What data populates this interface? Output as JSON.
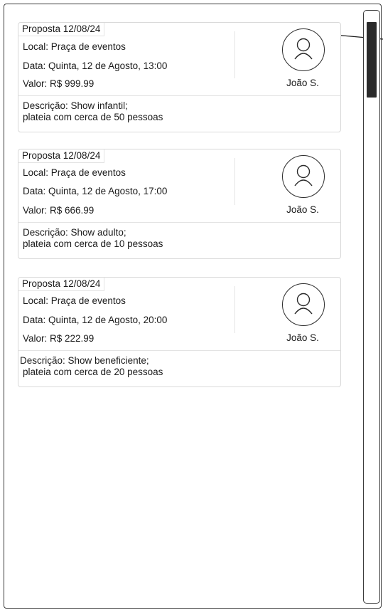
{
  "proposals": [
    {
      "title": "Proposta 12/08/24",
      "local": "Local: Praça de eventos",
      "data": "Data: Quinta, 12 de Agosto, 13:00",
      "valor": "Valor: R$ 999.99",
      "user": "João S.",
      "desc_line1": "Descrição: Show infantil;",
      "desc_line2": "plateia com cerca de 50 pessoas"
    },
    {
      "title": "Proposta 12/08/24",
      "local": "Local: Praça de eventos",
      "data": "Data: Quinta, 12 de Agosto, 17:00",
      "valor": "Valor: R$ 666.99",
      "user": "João S.",
      "desc_line1": "Descrição: Show adulto;",
      "desc_line2": "plateia com cerca de 10 pessoas"
    },
    {
      "title": "Proposta 12/08/24",
      "local": "Local: Praça de eventos",
      "data": "Data: Quinta, 12 de Agosto, 20:00",
      "valor": "Valor: R$ 222.99",
      "user": "João S.",
      "desc_line1": "Descrição: Show beneficiente;",
      "desc_line2": "plateia com cerca de 20 pessoas"
    }
  ],
  "icons": {
    "avatar": "user-icon"
  }
}
